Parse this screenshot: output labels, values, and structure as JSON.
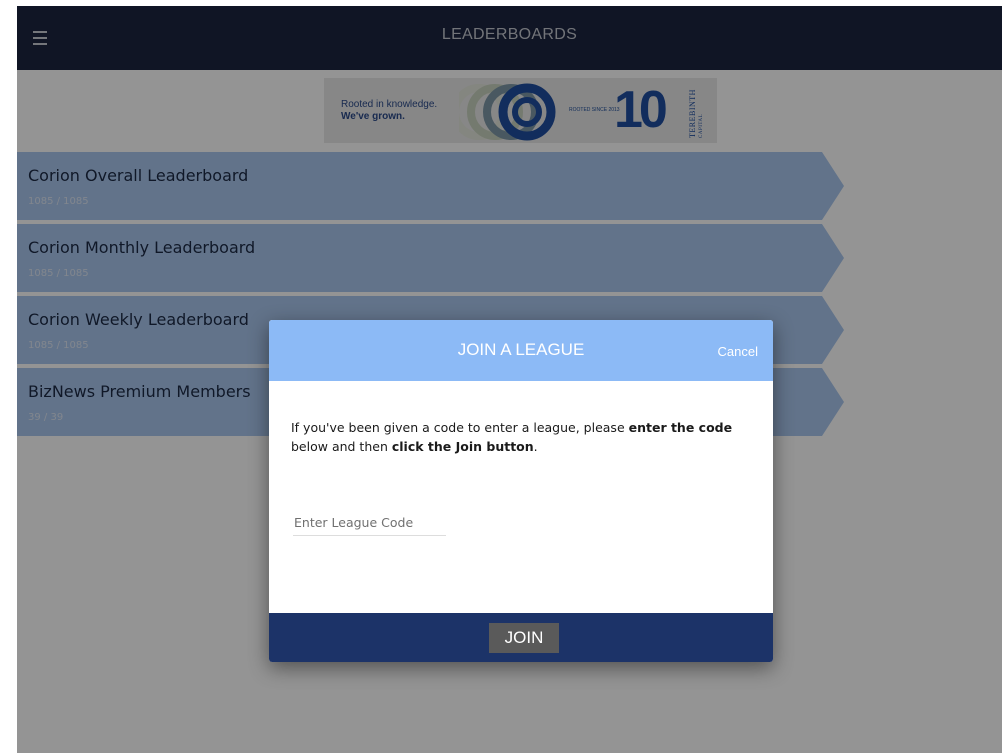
{
  "header": {
    "title": "LEADERBOARDS",
    "menu_icon": "hamburger-menu-icon"
  },
  "banner": {
    "line1": "Rooted in knowledge.",
    "line2": "We've grown.",
    "since": "ROOTED SINCE 2013",
    "ten": "10",
    "brand": "TEREBINTH",
    "brand_sub": "CAPITAL"
  },
  "leaderboards": [
    {
      "name": "Corion Overall Leaderboard",
      "count": "1085 / 1085"
    },
    {
      "name": "Corion Monthly Leaderboard",
      "count": "1085 / 1085"
    },
    {
      "name": "Corion Weekly Leaderboard",
      "count": "1085 / 1085"
    },
    {
      "name": "BizNews Premium Members",
      "count": "39 / 39"
    }
  ],
  "modal": {
    "title": "JOIN A LEAGUE",
    "cancel_label": "Cancel",
    "instr_1": "If you've been given a code to enter a league, please ",
    "instr_bold_1": "enter the code",
    "instr_2": " below and then ",
    "instr_bold_2": "click the Join button",
    "instr_3": ".",
    "input_placeholder": "Enter League Code",
    "input_value": "",
    "join_label": "JOIN"
  },
  "colors": {
    "topbar": "#1c2540",
    "row": "#a9c7ee",
    "modal_header": "#8cbaf6",
    "modal_footer": "#1c3368",
    "join_button": "#5a5a5a"
  }
}
